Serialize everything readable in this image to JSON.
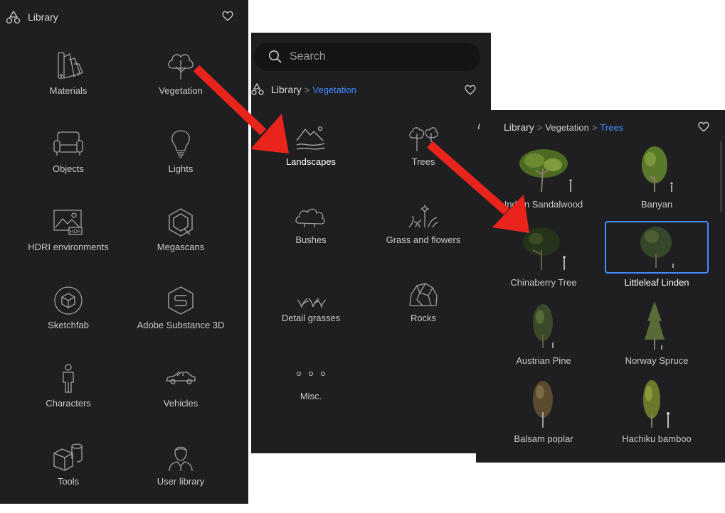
{
  "panel1": {
    "header": {
      "title": "Library"
    },
    "tiles": [
      {
        "label": "Materials",
        "icon": "swatch-fan-icon"
      },
      {
        "label": "Vegetation",
        "icon": "tree-icon"
      },
      {
        "label": "Objects",
        "icon": "sofa-icon"
      },
      {
        "label": "Lights",
        "icon": "lightbulb-icon"
      },
      {
        "label": "HDRI environments",
        "icon": "hdr-image-icon"
      },
      {
        "label": "Megascans",
        "icon": "megascans-icon"
      },
      {
        "label": "Sketchfab",
        "icon": "sketchfab-icon"
      },
      {
        "label": "Adobe Substance 3D",
        "icon": "substance-icon"
      },
      {
        "label": "Characters",
        "icon": "person-icon"
      },
      {
        "label": "Vehicles",
        "icon": "car-icon"
      },
      {
        "label": "Tools",
        "icon": "cube-cylinder-icon"
      },
      {
        "label": "User library",
        "icon": "user-icon"
      }
    ]
  },
  "panel2": {
    "search": {
      "placeholder": "Search"
    },
    "breadcrumb": {
      "root": "Library",
      "current": "Vegetation"
    },
    "tiles": [
      {
        "label": "Landscapes",
        "icon": "landscape-icon"
      },
      {
        "label": "Trees",
        "icon": "trees-icon"
      },
      {
        "label": "Bushes",
        "icon": "bush-icon"
      },
      {
        "label": "Grass and flowers",
        "icon": "grass-flower-icon"
      },
      {
        "label": "Detail grasses",
        "icon": "detail-grass-icon"
      },
      {
        "label": "Rocks",
        "icon": "rock-icon"
      },
      {
        "label": "Misc.",
        "icon": "dots-icon"
      }
    ]
  },
  "panel3": {
    "breadcrumb": {
      "root": "Library",
      "middle": "Vegetation",
      "current": "Trees"
    },
    "trees": [
      {
        "label": "Indian Sandalwood"
      },
      {
        "label": "Banyan"
      },
      {
        "label": "Chinaberry Tree"
      },
      {
        "label": "Littleleaf Linden"
      },
      {
        "label": "Austrian Pine"
      },
      {
        "label": "Norway Spruce"
      },
      {
        "label": "Balsam poplar"
      },
      {
        "label": "Hachiku bamboo"
      }
    ]
  },
  "colors": {
    "panel_bg": "#1f1f22",
    "accent": "#3f8cff",
    "arrow": "#e8241c"
  }
}
